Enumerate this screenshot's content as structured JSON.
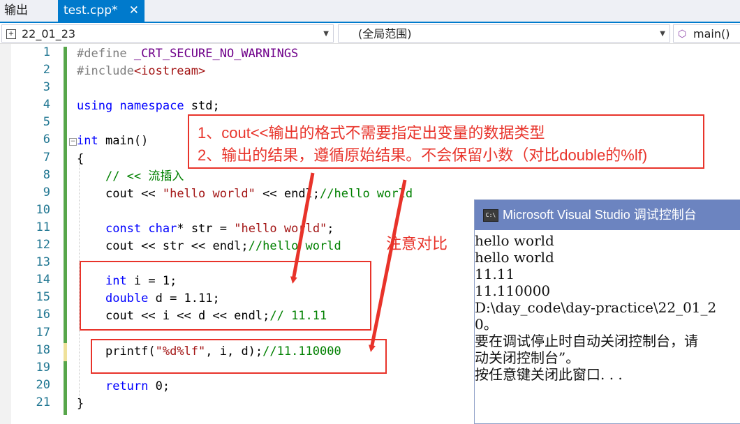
{
  "tabs": {
    "output_label": "输出",
    "file_label": "test.cpp*",
    "close_glyph": "✕"
  },
  "nav": {
    "project": "22_01_23",
    "scope": "(全局范围)",
    "member": "main()"
  },
  "line_numbers": [
    "1",
    "2",
    "3",
    "4",
    "5",
    "6",
    "7",
    "8",
    "9",
    "10",
    "11",
    "12",
    "13",
    "14",
    "15",
    "16",
    "17",
    "18",
    "19",
    "20",
    "21"
  ],
  "code_text": {
    "l1_pp": "#define",
    "l1_macro": " _CRT_SECURE_NO_WARNINGS",
    "l2_pp": "#include",
    "l2_hdr": "<iostream>",
    "l4_kw1": "using",
    "l4_kw2": "namespace",
    "l4_rest": " std;",
    "l6_kw": "int",
    "l6_rest": " main()",
    "l7": "{",
    "l8_cm": "// << 流插入",
    "l9_a": "cout << ",
    "l9_str": "\"hello world\"",
    "l9_b": " << endl;",
    "l9_cm": "//hello world",
    "l11_kw1": "const",
    "l11_kw2": "char",
    "l11_a": "* str = ",
    "l11_str": "\"hello world\"",
    "l11_b": ";",
    "l12_a": "cout << str << endl;",
    "l12_cm": "//hello world",
    "l14_kw": "int",
    "l14_rest": " i = 1;",
    "l15_kw": "double",
    "l15_rest": " d = 1.11;",
    "l16_a": "cout << i << d << endl;",
    "l16_cm": "// 11.11",
    "l18_a": "printf(",
    "l18_str": "\"%d%lf\"",
    "l18_b": ", i, d);",
    "l18_cm": "//11.110000",
    "l20_kw": "return",
    "l20_rest": " 0;",
    "l21": "}"
  },
  "annotations": {
    "note_line1": "1、cout<<输出的格式不需要指定出变量的数据类型",
    "note_line2": "2、输出的结果，遵循原始结果。不会保留小数（对比double的%lf)",
    "compare_label": "注意对比"
  },
  "console": {
    "title": "Microsoft Visual Studio 调试控制台",
    "lines": [
      "hello world",
      "hello world",
      "11.11",
      "11.110000",
      "D:\\day_code\\day-practice\\22_01_2",
      "0。",
      "要在调试停止时自动关闭控制台，请",
      "动关闭控制台”。",
      "按任意键关闭此窗口. . ."
    ]
  },
  "colors": {
    "accent": "#007acc",
    "annotation_red": "#e8332a",
    "console_title_bg": "#6c84c0",
    "keyword": "#0000ff",
    "string": "#a31515",
    "comment": "#008000"
  },
  "icons": {
    "project": "project-icon",
    "member": "method-cube-icon",
    "console": "console-app-icon"
  }
}
